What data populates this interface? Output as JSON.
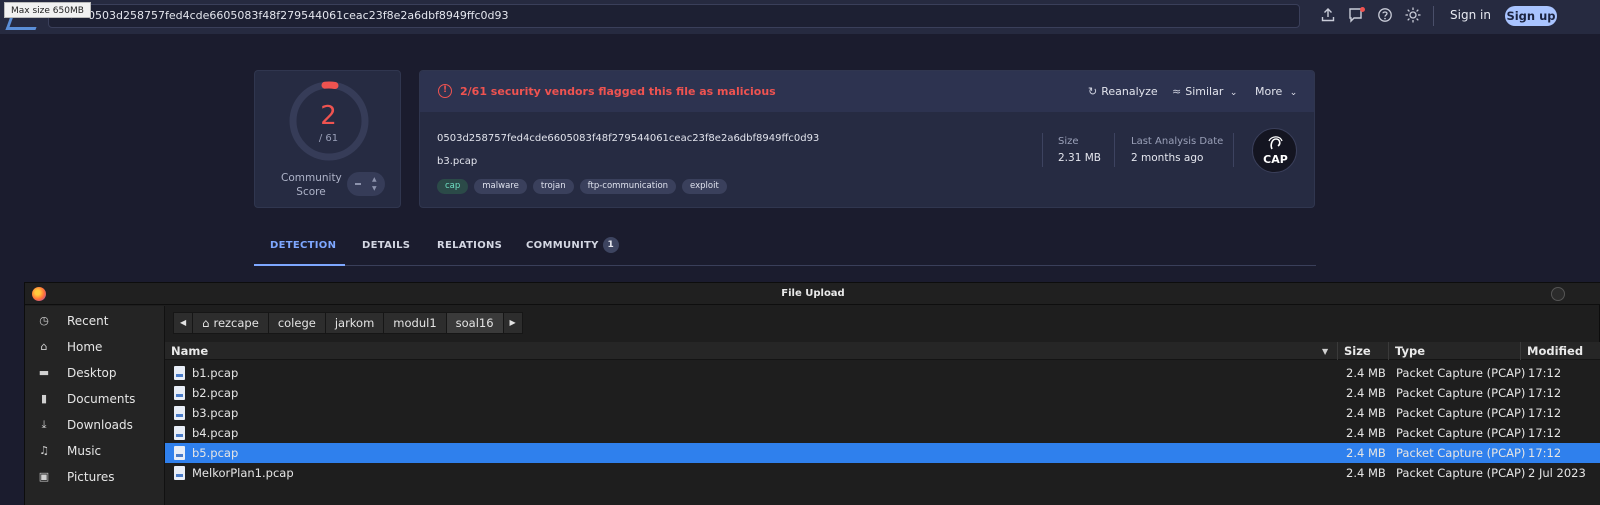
{
  "topbar": {
    "tooltip": "Max size 650MB",
    "search_value": "0503d258757fed4cde6605083f48f279544061ceac23f8e2a6dbf8949ffc0d93",
    "sign_in": "Sign in",
    "sign_up": "Sign up",
    "icons": [
      "upload-icon",
      "chat-icon",
      "help-icon",
      "theme-icon"
    ]
  },
  "score": {
    "detections": "2",
    "total": "/ 61",
    "community_label": "Community Score"
  },
  "summary": {
    "flag_text": "2/61 security vendors flagged this file as malicious",
    "actions": {
      "reanalyze": "Reanalyze",
      "similar": "Similar",
      "more": "More"
    },
    "hash": "0503d258757fed4cde6605083f48f279544061ceac23f8e2a6dbf8949ffc0d93",
    "filename": "b3.pcap",
    "tags": [
      "cap",
      "malware",
      "trojan",
      "ftp-communication",
      "exploit"
    ],
    "size_label": "Size",
    "size_value": "2.31 MB",
    "last_analysis_label": "Last Analysis Date",
    "last_analysis_value": "2 months ago",
    "file_type_logo": "CAP"
  },
  "tabs": {
    "detection": "DETECTION",
    "details": "DETAILS",
    "relations": "RELATIONS",
    "community": "COMMUNITY",
    "community_count": "1"
  },
  "dialog": {
    "title": "File Upload",
    "places": [
      "Recent",
      "Home",
      "Desktop",
      "Documents",
      "Downloads",
      "Music",
      "Pictures"
    ],
    "path": [
      "rezcape",
      "colege",
      "jarkom",
      "modul1",
      "soal16"
    ],
    "columns": {
      "name": "Name",
      "size": "Size",
      "type": "Type",
      "modified": "Modified"
    },
    "files": [
      {
        "name": "b1.pcap",
        "size": "2.4 MB",
        "type": "Packet Capture (PCAP)",
        "modified": "17:12"
      },
      {
        "name": "b2.pcap",
        "size": "2.4 MB",
        "type": "Packet Capture (PCAP)",
        "modified": "17:12"
      },
      {
        "name": "b3.pcap",
        "size": "2.4 MB",
        "type": "Packet Capture (PCAP)",
        "modified": "17:12"
      },
      {
        "name": "b4.pcap",
        "size": "2.4 MB",
        "type": "Packet Capture (PCAP)",
        "modified": "17:12"
      },
      {
        "name": "b5.pcap",
        "size": "2.4 MB",
        "type": "Packet Capture (PCAP)",
        "modified": "17:12"
      },
      {
        "name": "MelkorPlan1.pcap",
        "size": "2.4 MB",
        "type": "Packet Capture (PCAP)",
        "modified": "2 Jul 2023"
      }
    ],
    "selected_file": "b5.pcap"
  },
  "colors": {
    "malicious": "#ef5350",
    "accent": "#7ea7ff",
    "selection": "#2f80ed"
  }
}
